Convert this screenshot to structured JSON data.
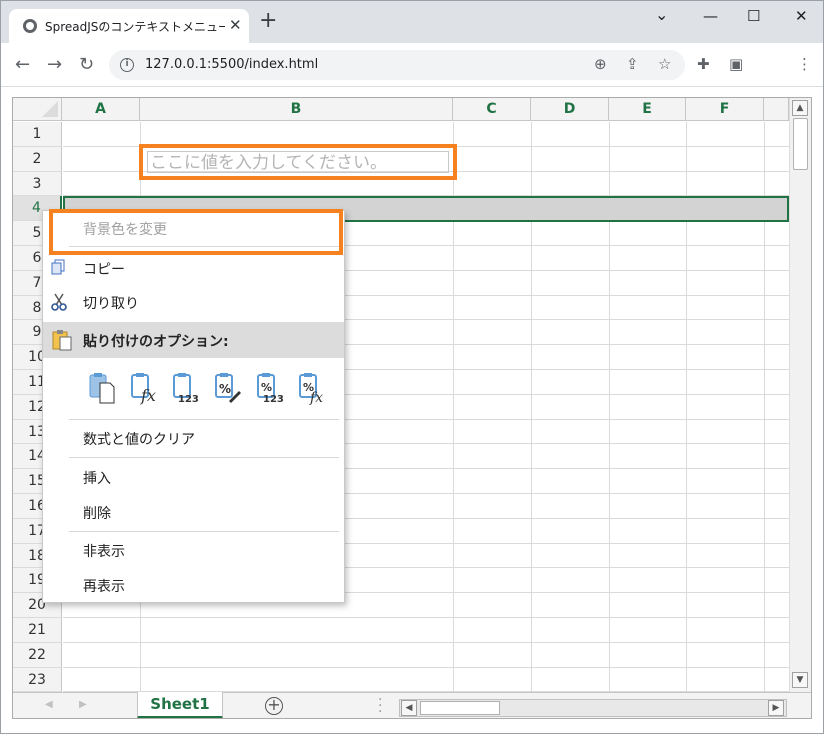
{
  "browser": {
    "tab_title": "SpreadJSのコンテキストメニューのカスタ",
    "tab_close": "✕",
    "new_tab": "+",
    "url": "127.0.0.1:5500/index.html",
    "window_controls": {
      "minimize": "—",
      "maximize": "☐",
      "close": "✕"
    },
    "chevron": "⌄"
  },
  "spread": {
    "columns": [
      "A",
      "B",
      "C",
      "D",
      "E",
      "F"
    ],
    "rows": [
      "1",
      "2",
      "3",
      "4",
      "5",
      "6",
      "7",
      "8",
      "9",
      "10",
      "11",
      "12",
      "13",
      "14",
      "15",
      "16",
      "17",
      "18",
      "19",
      "20",
      "21",
      "22",
      "23"
    ],
    "selected_row": "4",
    "watermark": "ここに値を入力してください。",
    "sheet_tab": "Sheet1"
  },
  "context_menu": {
    "items": [
      {
        "label": "背景色を変更",
        "disabled": true
      },
      {
        "label": "コピー",
        "icon": "copy-icon"
      },
      {
        "label": "切り取り",
        "icon": "scissors-icon"
      },
      {
        "label": "貼り付けのオプション:",
        "icon": "clipboard-icon",
        "header": true
      },
      {
        "label": "数式と値のクリア"
      },
      {
        "label": "挿入"
      },
      {
        "label": "削除"
      },
      {
        "label": "非表示"
      },
      {
        "label": "再表示"
      }
    ],
    "paste_options": [
      {
        "name": "paste-all-icon"
      },
      {
        "name": "paste-formulas-icon",
        "glyph": "fx"
      },
      {
        "name": "paste-values-icon",
        "glyph": "123"
      },
      {
        "name": "paste-formatting-icon",
        "glyph": "%"
      },
      {
        "name": "paste-values-formatting-icon",
        "glyph": "%123"
      },
      {
        "name": "paste-formulas-formatting-icon",
        "glyph": "%fx"
      }
    ]
  },
  "colors": {
    "accent": "#217346",
    "highlight": "#f5821f"
  }
}
